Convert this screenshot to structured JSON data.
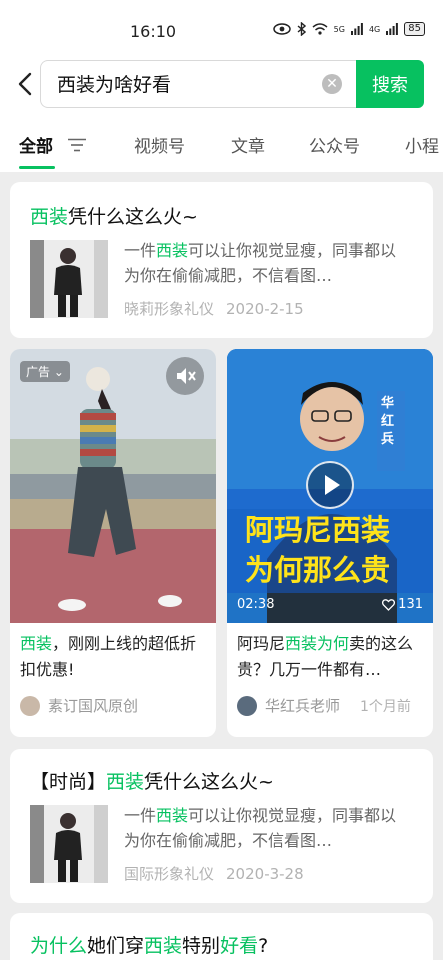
{
  "status_bar": {
    "time": "16:10",
    "signal1": "5G",
    "signal2": "4G",
    "battery": "85"
  },
  "search": {
    "query": "西装为啥好看",
    "button_label": "搜索"
  },
  "tabs": [
    "全部",
    "视频号",
    "文章",
    "公众号",
    "小程"
  ],
  "articles": [
    {
      "title_prefix": "",
      "title_hl": "西装",
      "title_rest": "凭什么这么火~",
      "snippet_a": "一件",
      "snippet_hl": "西装",
      "snippet_b": "可以让你视觉显瘦，同事都以为你在偷偷减肥，不信看图…",
      "source": "晓莉形象礼仪",
      "date": "2020-2-15"
    },
    {
      "title_prefix": "【时尚】",
      "title_hl": "西装",
      "title_rest": "凭什么这么火~",
      "snippet_a": "一件",
      "snippet_hl": "西装",
      "snippet_b": "可以让你视觉显瘦，同事都以为你在偷偷减肥，不信看图…",
      "source": "国际形象礼仪",
      "date": "2020-3-28"
    }
  ],
  "videos": [
    {
      "ad_badge": "广告",
      "title_hl": "西装",
      "title_rest": "，刚刚上线的超低折扣优惠!",
      "author": "素订国风原创"
    },
    {
      "overlay_name": "华红兵",
      "overlay_line1": "阿玛尼西装",
      "overlay_line2": "为何那么贵",
      "duration": "02:38",
      "likes": "131",
      "title_a": "阿玛尼",
      "title_hl": "西装为何",
      "title_b": "卖的这么贵？几万一件都有…",
      "author": "华红兵老师",
      "time_ago": "1个月前"
    }
  ],
  "bottom_article": {
    "title_hl1": "为什么",
    "title_mid": "她们穿",
    "title_hl2": "西装",
    "title_mid2": "特别",
    "title_hl3": "好看",
    "title_end": "?"
  },
  "colors": {
    "accent": "#07c160",
    "background": "#ededed"
  },
  "icons": [
    "back-arrow-icon",
    "clear-icon",
    "filter-icon",
    "mute-icon",
    "play-icon",
    "heart-icon",
    "eye-icon",
    "bluetooth-icon",
    "wifi-icon"
  ]
}
